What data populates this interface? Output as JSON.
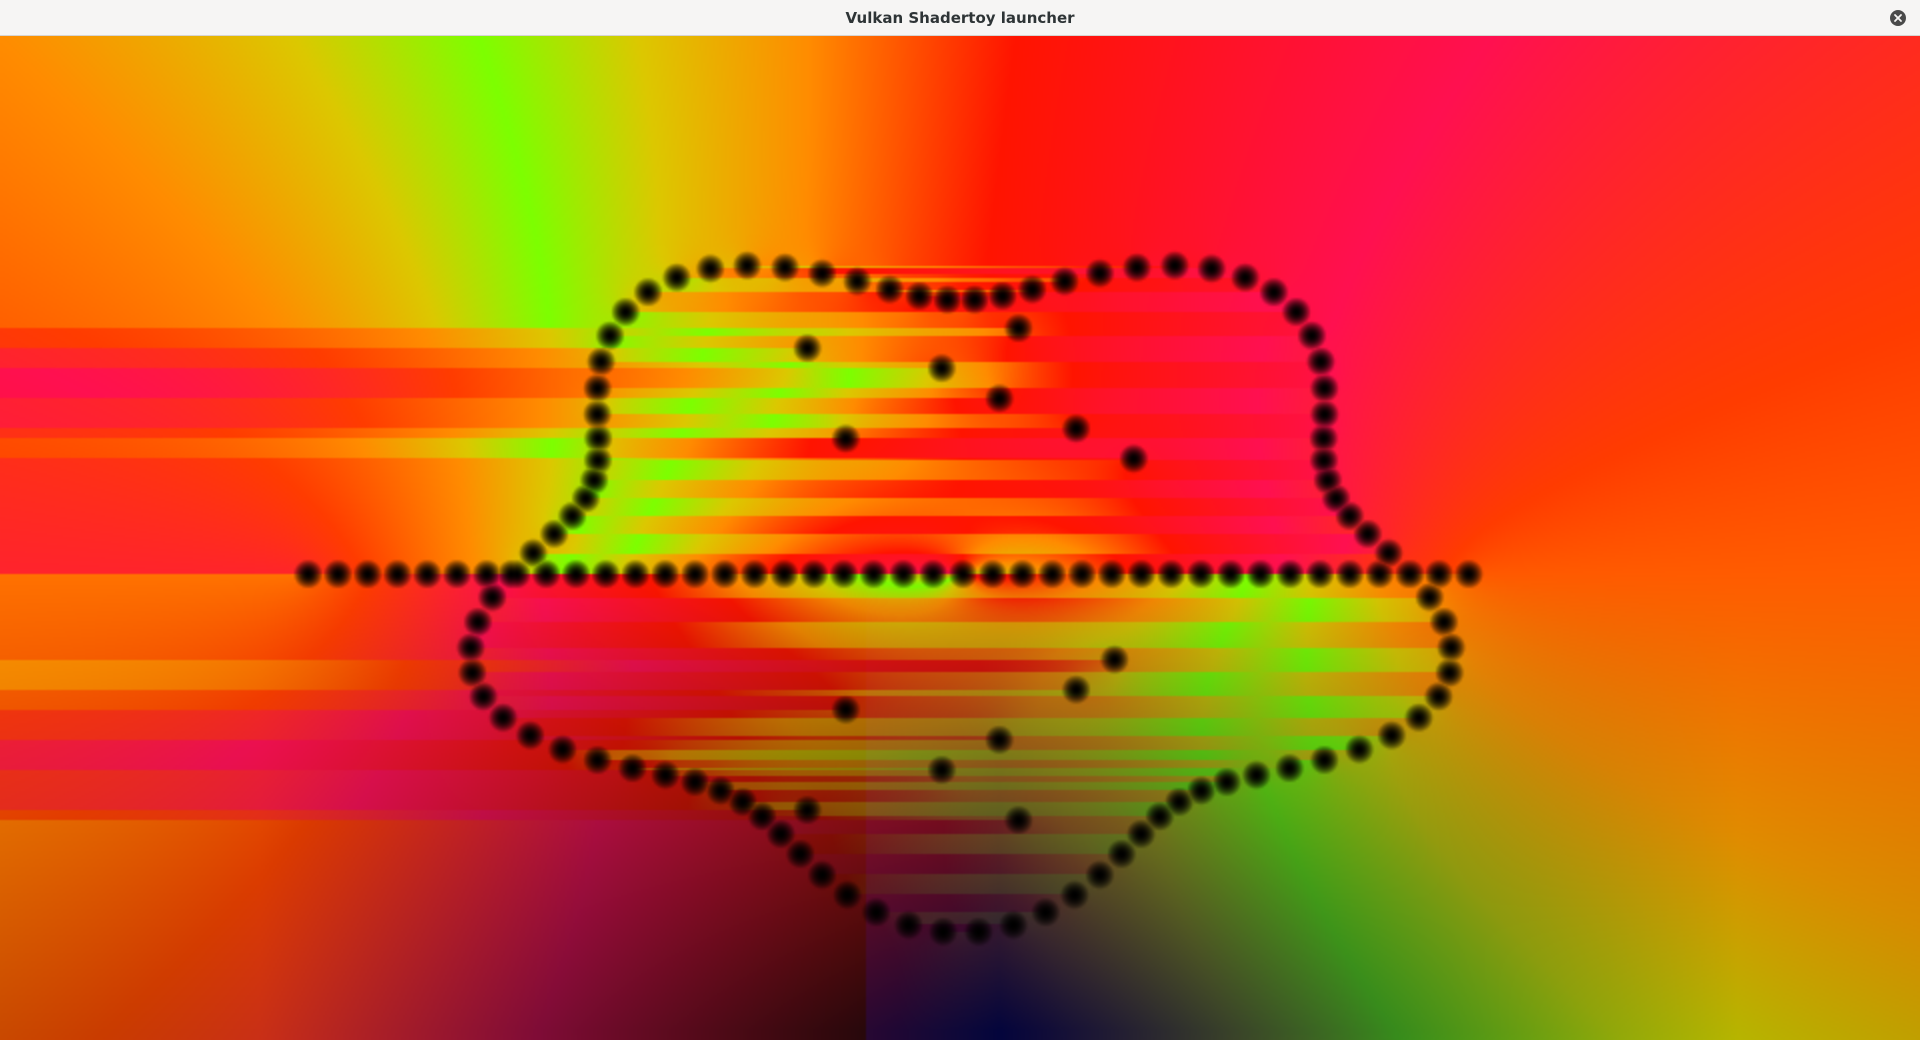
{
  "window": {
    "title": "Vulkan Shadertoy launcher"
  },
  "controls": {
    "close_icon": "close-icon"
  },
  "shader": {
    "render_style": "domain-coloring fractal",
    "colors": {
      "green": "#7dff00",
      "yellow": "#e8c000",
      "orange": "#ff8a00",
      "red": "#ff1000",
      "crimson": "#ff1550",
      "navy": "#000040",
      "black": "#000000"
    }
  }
}
